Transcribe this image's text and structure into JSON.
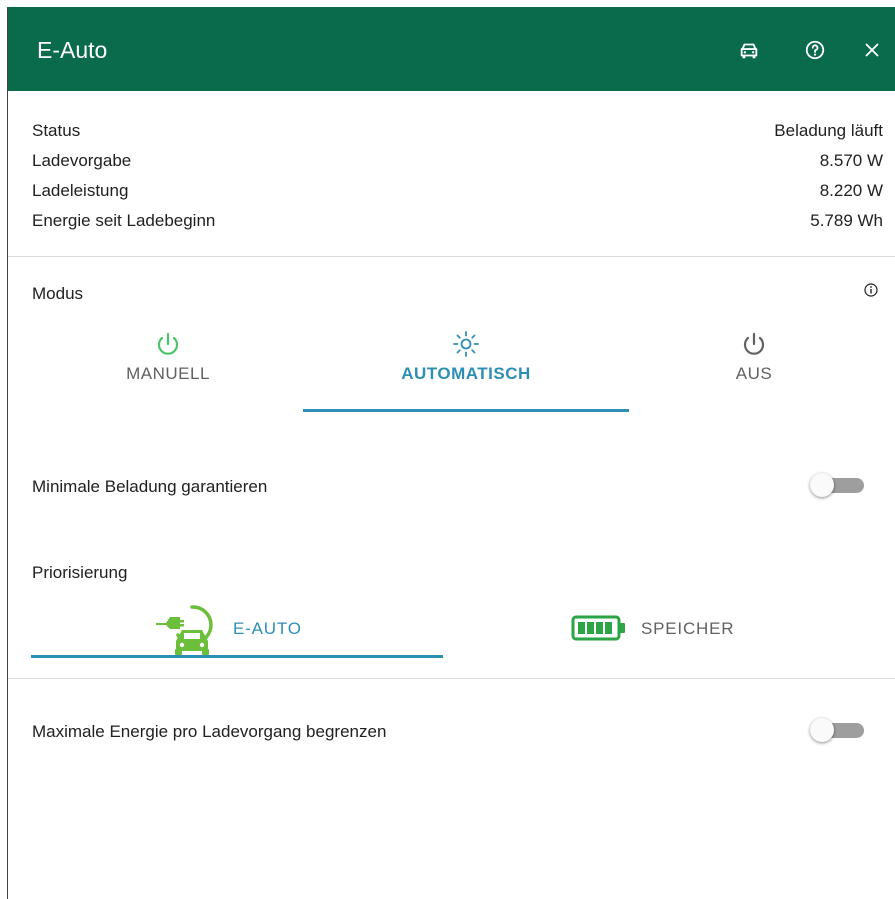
{
  "header": {
    "title": "E-Auto"
  },
  "info": [
    {
      "label": "Status",
      "value": "Beladung läuft"
    },
    {
      "label": "Ladevorgabe",
      "value": "8.570 W"
    },
    {
      "label": "Ladeleistung",
      "value": "8.220 W"
    },
    {
      "label": "Energie seit Ladebeginn",
      "value": "5.789 Wh"
    }
  ],
  "mode": {
    "label": "Modus",
    "tabs": [
      {
        "label": "MANUELL",
        "icon": "power-icon"
      },
      {
        "label": "AUTOMATISCH",
        "icon": "sun-icon"
      },
      {
        "label": "AUS",
        "icon": "power-icon"
      }
    ],
    "active": "AUTOMATISCH"
  },
  "min_charge": {
    "label": "Minimale Beladung garantieren",
    "enabled": false
  },
  "priority": {
    "label": "Priorisierung",
    "tabs": [
      {
        "label": "E-AUTO",
        "icon": "ev-car-icon"
      },
      {
        "label": "SPEICHER",
        "icon": "battery-icon"
      }
    ],
    "active": "E-AUTO"
  },
  "max_energy": {
    "label": "Maximale Energie pro Ladevorgang begrenzen",
    "enabled": false
  },
  "colors": {
    "header": "#0a6a4c",
    "accent": "#2e8fb5",
    "green": "#4cc46a",
    "ev_green": "#6cbf3a",
    "battery_green": "#2aa444"
  }
}
